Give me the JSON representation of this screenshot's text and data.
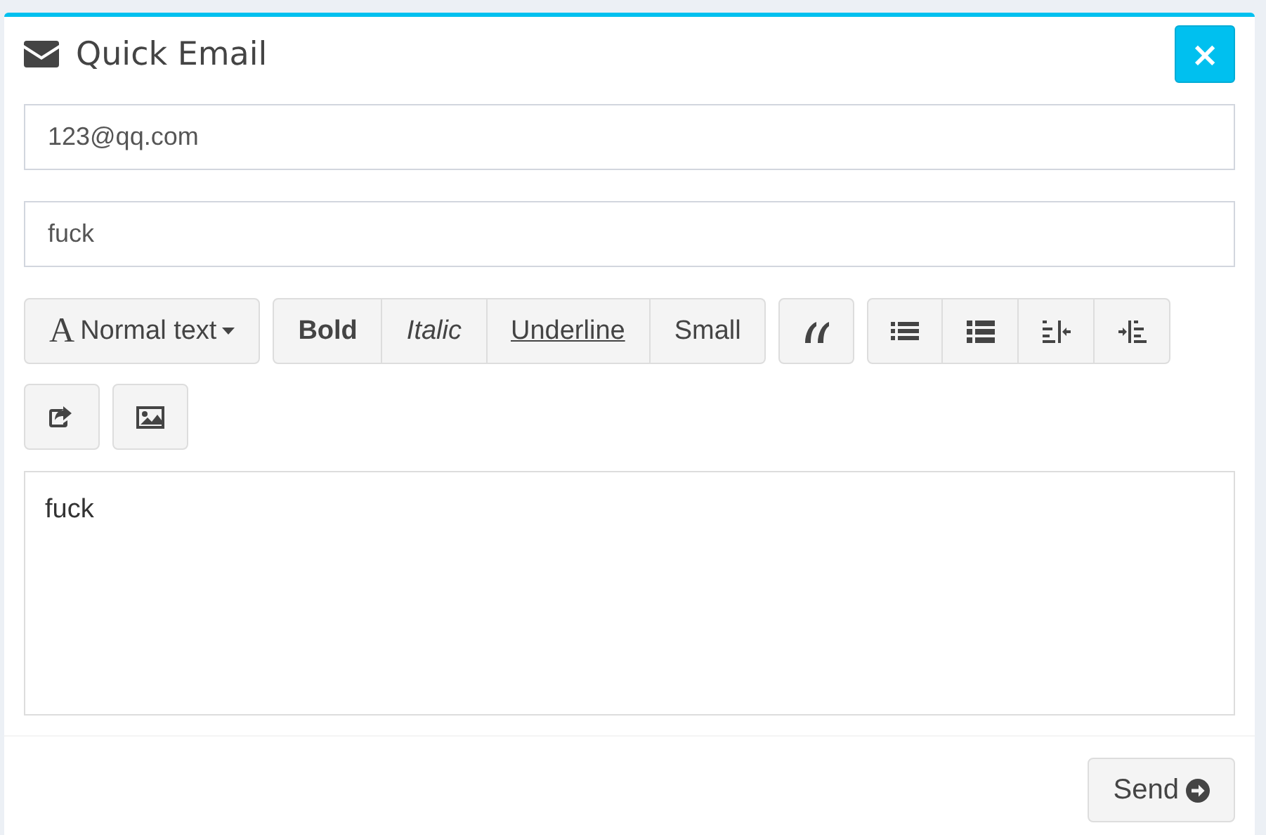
{
  "header": {
    "title": "Quick Email",
    "close_symbol": "×"
  },
  "recipient": {
    "value": "123@qq.com"
  },
  "subject": {
    "value": "fuck"
  },
  "toolbar": {
    "style_dropdown": {
      "glyph": "A",
      "label": "Normal text"
    },
    "groups": [
      [
        {
          "kind": "bold",
          "label": "Bold"
        },
        {
          "kind": "italic",
          "label": "Italic"
        },
        {
          "kind": "underline",
          "label": "Underline"
        },
        {
          "kind": "small",
          "label": "Small"
        }
      ],
      [
        {
          "kind": "quote"
        }
      ],
      [
        {
          "kind": "bullet-list"
        },
        {
          "kind": "number-list"
        },
        {
          "kind": "outdent"
        },
        {
          "kind": "indent"
        }
      ],
      [
        {
          "kind": "link"
        }
      ],
      [
        {
          "kind": "image"
        }
      ]
    ]
  },
  "editor": {
    "value": "fuck"
  },
  "footer": {
    "send_label": "Send"
  }
}
